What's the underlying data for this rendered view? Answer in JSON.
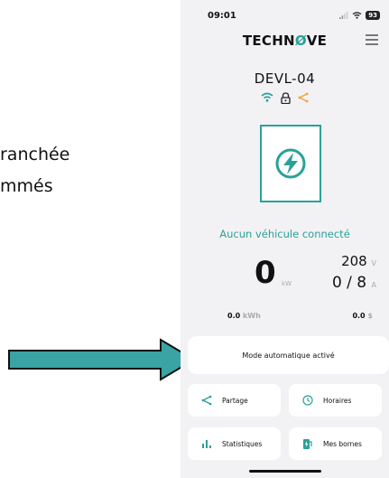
{
  "partial_text": {
    "line1": "ranchée",
    "line2": "mmés"
  },
  "status_bar": {
    "time": "09:01",
    "battery": "93"
  },
  "header": {
    "logo_prefix": "TECHN",
    "logo_accent": "Ø",
    "logo_suffix": "VE"
  },
  "device": {
    "name": "DEVL-04"
  },
  "connection": {
    "status": "Aucun véhicule connecté"
  },
  "metrics": {
    "power_value": "0",
    "power_unit": "kW",
    "voltage_value": "208",
    "voltage_unit": "V",
    "current_value": "0 / 8",
    "current_unit": "A",
    "energy_value": "0.0",
    "energy_unit": "kWh",
    "cost_value": "0.0",
    "cost_unit": "$"
  },
  "mode": {
    "label": "Mode automatique activé"
  },
  "tiles": {
    "partage": "Partage",
    "horaires": "Horaires",
    "statistiques": "Statistiques",
    "bornes": "Mes bornes"
  },
  "colors": {
    "accent": "#2aa198",
    "arrow": "#3aa3a3",
    "share": "#f2a33a"
  }
}
